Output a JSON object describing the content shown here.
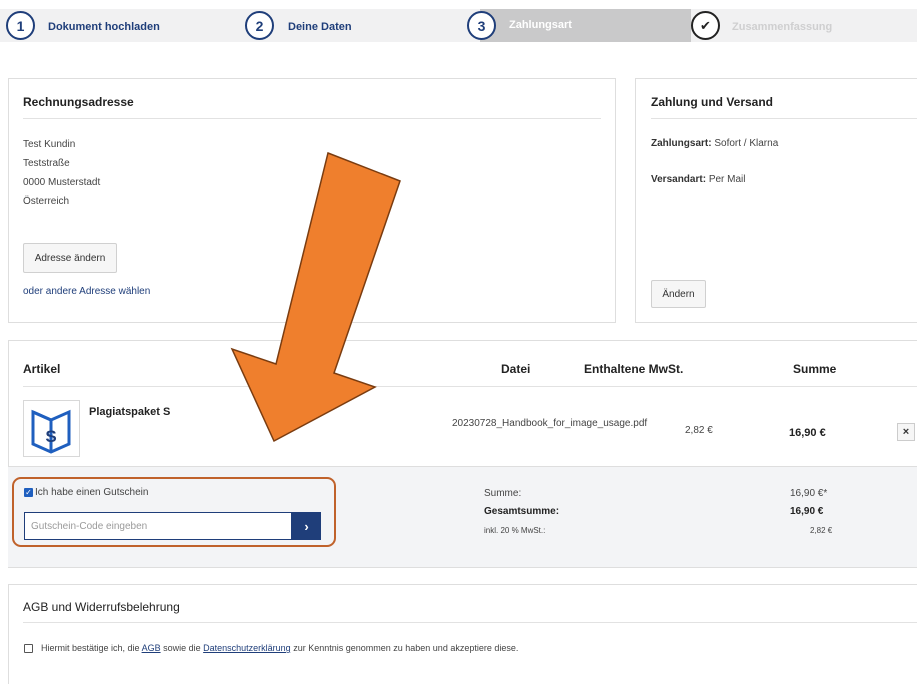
{
  "steps": [
    {
      "number": "1",
      "label": "Dokument hochladen"
    },
    {
      "number": "2",
      "label": "Deine Daten"
    },
    {
      "number": "3",
      "label": "Zahlungsart"
    },
    {
      "number": "✔",
      "label": "Zusammenfassung"
    }
  ],
  "billing": {
    "title": "Rechnungsadresse",
    "lines": [
      "Test Kundin",
      "Teststraße",
      "0000 Musterstadt",
      "Österreich"
    ],
    "change_button": "Adresse ändern",
    "other_link": "oder andere Adresse wählen"
  },
  "payment": {
    "title": "Zahlung und Versand",
    "method_label": "Zahlungsart:",
    "method_value": "Sofort / Klarna",
    "shipping_label": "Versandart:",
    "shipping_value": "Per Mail",
    "change_button": "Ändern"
  },
  "cart": {
    "headers": {
      "article": "Artikel",
      "file": "Datei",
      "vat": "Enthaltene MwSt.",
      "sum": "Summe"
    },
    "item": {
      "name": "Plagiatspaket S",
      "file": "20230728_Handbook_for_image_usage.pdf",
      "vat": "2,82 €",
      "sum": "16,90 €",
      "remove": "×"
    }
  },
  "voucher": {
    "checkbox_label": "Ich habe einen Gutschein",
    "placeholder": "Gutschein-Code eingeben",
    "submit": "›"
  },
  "totals": {
    "sum_label": "Summe:",
    "sum_value": "16,90 €*",
    "total_label": "Gesamtsumme:",
    "total_value": "16,90 €",
    "vat_label": "inkl. 20 % MwSt.:",
    "vat_value": "2,82 €"
  },
  "terms": {
    "title": "AGB und Widerrufsbelehrung",
    "text_before": "Hiermit bestätige ich, die",
    "agb_link": "AGB",
    "text_middle": "sowie die",
    "privacy_link": "Datenschutzerklärung",
    "text_after": "zur Kenntnis genommen zu haben und akzeptiere diese."
  },
  "colors": {
    "brand": "#1f3e7a",
    "arrow": "#ef7f2d",
    "highlight": "#c0622b"
  }
}
